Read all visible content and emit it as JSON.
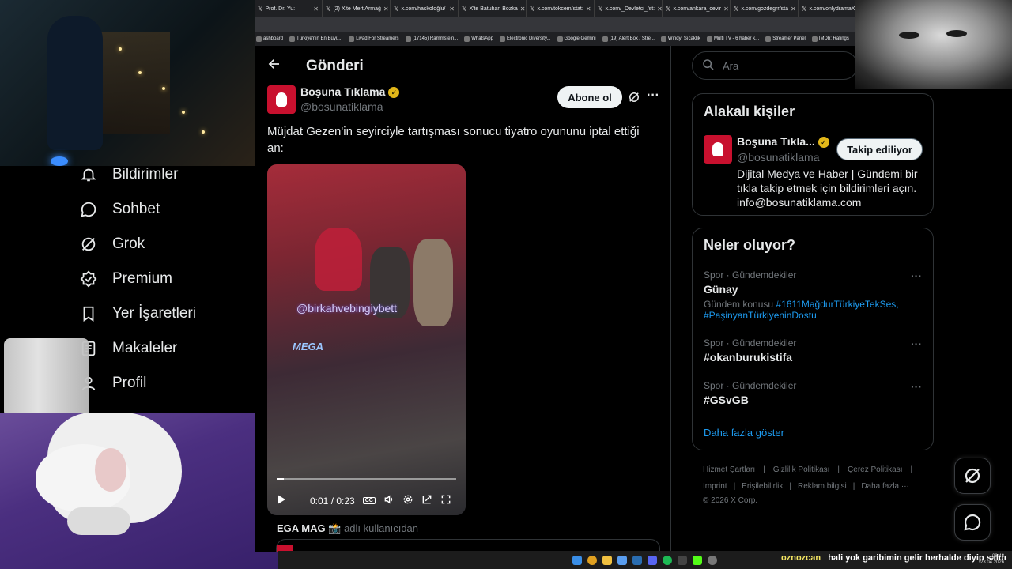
{
  "browser": {
    "tabs": [
      "Prof. Dr. Yu:",
      "(2) X'te Mert Armağ",
      "x.com/haskoloğlu/",
      "X'te Batuhan Bozka",
      "x.com/tokcem/stat:",
      "x.com/_Devletci_/st:",
      "x.com/ankara_cevir",
      "x.com/gozdegrr/sta",
      "x.com/onlydramaX:"
    ],
    "bookmarks": [
      "ashboard",
      "Türkiye'nin En Büyü...",
      "Livad For Streamers",
      "(17145) Rammstein...",
      "WhatsApp",
      "Electronic Diversity...",
      "Google Gemini",
      "(19) Alert Box / Stre...",
      "Windy: Sıcaklık",
      "Multi TV - 6 haber k...",
      "Streamer Panel",
      "IMDb: Ratings"
    ]
  },
  "nav": {
    "items": [
      {
        "label": "Bildirimler",
        "icon": "bell-icon"
      },
      {
        "label": "Sohbet",
        "icon": "chat-icon"
      },
      {
        "label": "Grok",
        "icon": "grok-icon"
      },
      {
        "label": "Premium",
        "icon": "premium-badge-icon"
      },
      {
        "label": "Yer İşaretleri",
        "icon": "bookmark-icon"
      },
      {
        "label": "Makaleler",
        "icon": "article-icon"
      },
      {
        "label": "Profil",
        "icon": "profile-icon"
      }
    ]
  },
  "post": {
    "header_title": "Gönderi",
    "author_name": "Boşuna Tıklama",
    "author_handle": "@bosunatiklama",
    "follow_label": "Abone ol",
    "text": "Müjdat Gezen'in seyirciyle tartışması sonucu tiyatro oyununu iptal ettiği an:",
    "video": {
      "watermark": "@birkahvebingiybett",
      "logo_text": "MEGA",
      "time": "0:01 / 0:23",
      "progress": 0.04
    },
    "source_name": "EGA MAG 📸",
    "source_suffix": "adlı kullanıcıdan"
  },
  "sidebar": {
    "search_placeholder": "Ara",
    "related": {
      "title": "Alakalı kişiler",
      "name": "Boşuna Tıkla...",
      "handle": "@bosunatiklama",
      "button": "Takip ediliyor",
      "bio": "Dijital Medya ve Haber | Gündemi bir tıkla takip etmek için bildirimleri açın. info@bosunatiklama.com"
    },
    "trends": {
      "title": "Neler oluyor?",
      "items": [
        {
          "meta": "Spor · Gündemdekiler",
          "title": "Günay",
          "sub_prefix": "Gündem konusu",
          "sub_links": "#1611MağdurTürkiyeTekSes, #PaşinyanTürkiyeninDostu"
        },
        {
          "meta": "Spor · Gündemdekiler",
          "title": "#okanburukistifa"
        },
        {
          "meta": "Spor · Gündemdekiler",
          "title": "#GSvGB"
        }
      ],
      "more": "Daha fazla göster"
    },
    "footer": {
      "row1": [
        "Hizmet Şartları",
        "Gizlilik Politikası",
        "Çerez Politikası"
      ],
      "row2": [
        "Imprint",
        "Erişilebilirlik",
        "Reklam bilgisi",
        "Daha fazla ···"
      ],
      "copyright": "© 2026 X Corp."
    }
  },
  "stream": {
    "chat_user": "oznozcan",
    "chat_message": "hali yok garibimin gelir herhalde diyip saldı",
    "clock_time": "08:43",
    "clock_date": "23.04.2026"
  },
  "colors": {
    "accent": "#1d9bf0",
    "verified": "#e2b719",
    "brand_red": "#c8102e",
    "chat_user": "#f5e663"
  }
}
